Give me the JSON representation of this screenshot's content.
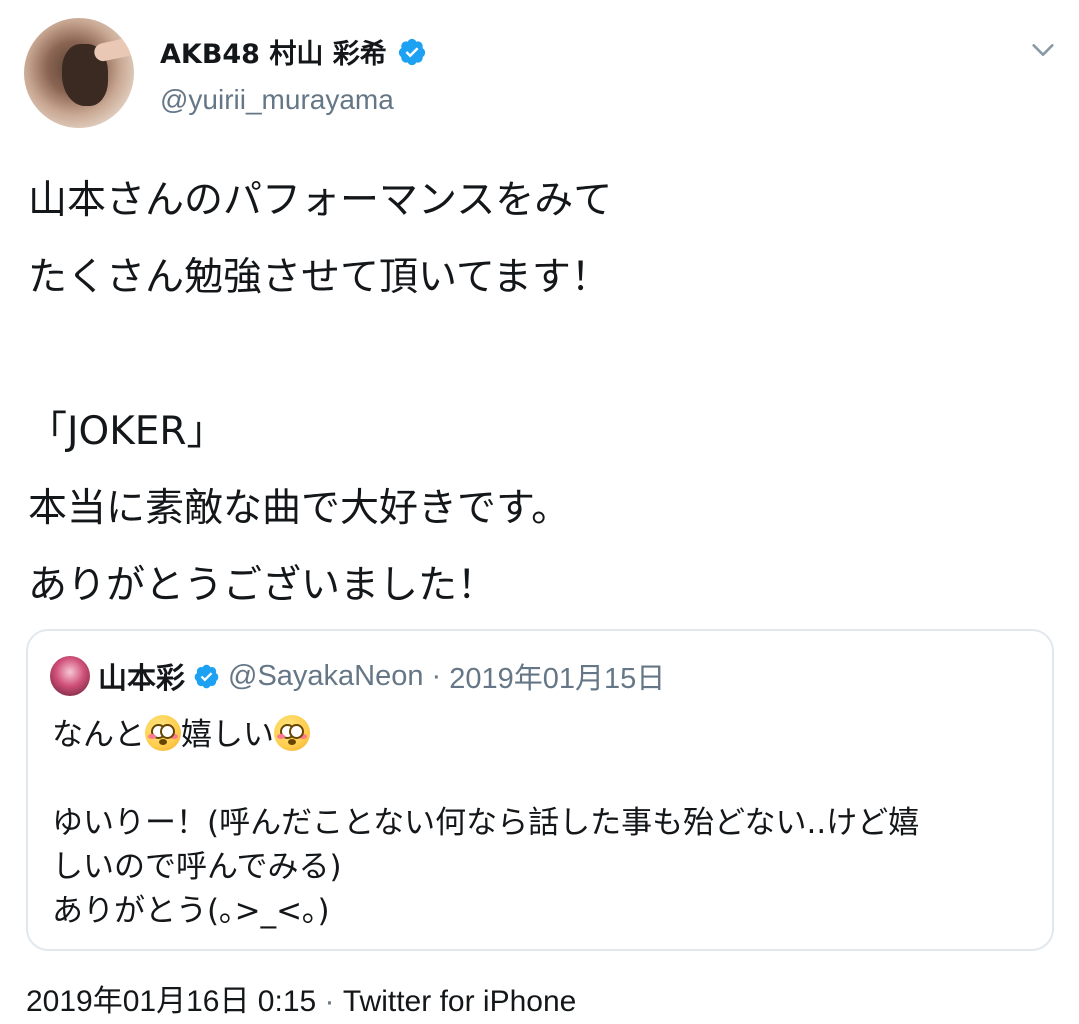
{
  "author": {
    "display_name": "AKB48 村山 彩希",
    "handle": "@yuirii_murayama",
    "verified": true
  },
  "tweet": {
    "lines": [
      "山本さんのパフォーマンスをみて",
      "たくさん勉強させて頂いてます！",
      "",
      "「JOKER」",
      "本当に素敵な曲で大好きです。",
      "ありがとうございました！"
    ]
  },
  "quoted_tweet": {
    "display_name": "山本彩",
    "handle": "@SayakaNeon",
    "separator": "·",
    "date": "2019年01月15日",
    "line1_a": "なんと",
    "line1_b": "嬉しい",
    "line2": "ゆいりー！(呼んだことない何なら話した事も殆どない..けど嬉",
    "line3": "しいので呼んでみる)",
    "line4": "ありがとう(｡>_<｡)",
    "emoji": "flushed-face-icon"
  },
  "footer": {
    "timestamp": "2019年01月16日 0:15",
    "separator": "·",
    "source": "Twitter for iPhone"
  },
  "colors": {
    "text_primary": "#14171a",
    "text_secondary": "#657786",
    "verified_blue": "#1da1f2",
    "border": "#e1e8ed"
  }
}
